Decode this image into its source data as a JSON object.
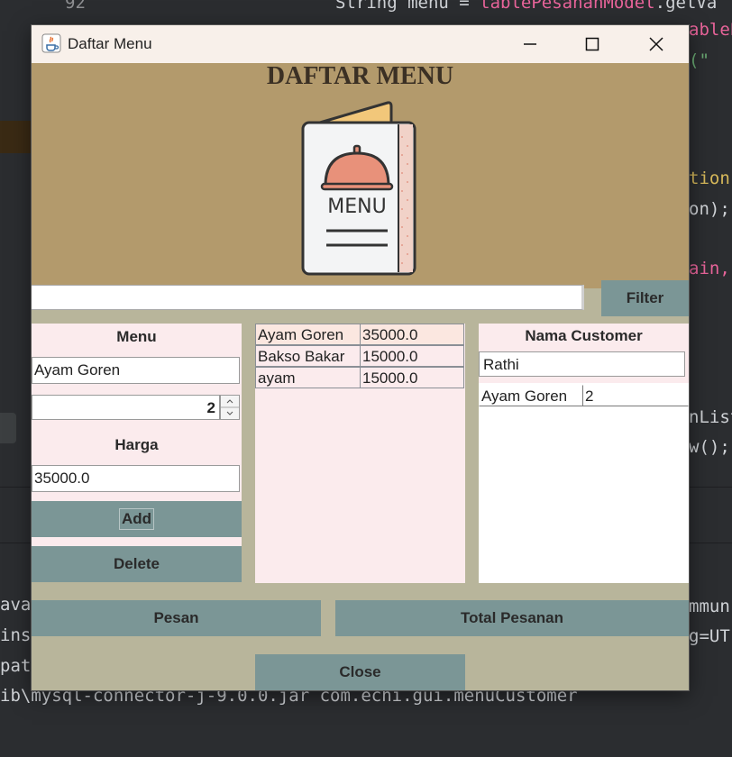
{
  "ide": {
    "line_number": "92",
    "code_lines": [
      "String menu = tablePesananModel.getVa",
      "ablePe",
      "(\"",
      "tion(",
      "on);",
      "ain,",
      "nList",
      "w();"
    ],
    "terminal_lines": [
      "ava",
      "ins\\",
      "path",
      "ib\\mysql-connector-j-9.0.0.jar com.echi.gui.menuCustomer"
    ],
    "terminal_right": [
      "mmun",
      "g=UT"
    ]
  },
  "window": {
    "title": "Daftar Menu",
    "banner_title": "DAFTAR MENU",
    "menu_art_text": "MENU"
  },
  "search": {
    "value": "",
    "filter_label": "Filter"
  },
  "left_panel": {
    "menu_label": "Menu",
    "menu_value": "Ayam Goren",
    "quantity_value": "2",
    "harga_label": "Harga",
    "harga_value": "35000.0",
    "add_label": "Add",
    "delete_label": "Delete"
  },
  "menu_table": {
    "rows": [
      [
        "Ayam Goren",
        "35000.0"
      ],
      [
        "Bakso Bakar",
        "15000.0"
      ],
      [
        "ayam",
        "15000.0"
      ]
    ]
  },
  "customer_panel": {
    "label": "Nama Customer",
    "name_value": "Rathi",
    "orders": [
      [
        "Ayam Goren",
        "2"
      ]
    ]
  },
  "actions": {
    "pesan_label": "Pesan",
    "total_label": "Total Pesanan",
    "close_label": "Close"
  },
  "colors": {
    "banner": "#b39a6c",
    "window_bg": "#b8b59b",
    "button": "#7b9696",
    "panel": "#fbebed"
  }
}
